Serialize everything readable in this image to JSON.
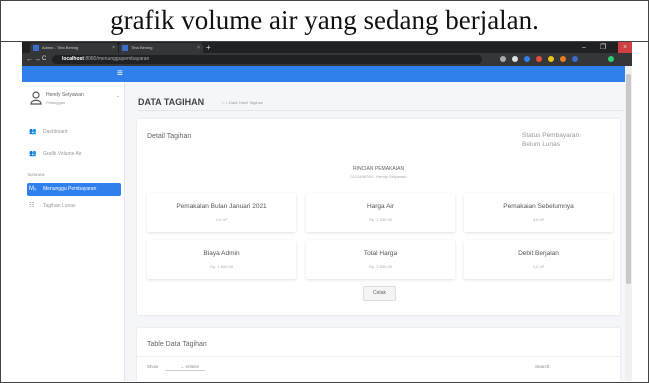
{
  "caption": "grafik volume air yang sedang berjalan.",
  "browser": {
    "tabs": [
      {
        "title": "Admin - Tirta Bening",
        "close": "×"
      },
      {
        "title": "Tirta Bening",
        "close": "×"
      }
    ],
    "new_tab": "+",
    "window_controls": {
      "minimize": "–",
      "maximize": "❐",
      "close": "×"
    },
    "nav": {
      "back": "←",
      "forward": "→",
      "reload": "C"
    },
    "url_host": "localhost",
    "url_path": ":8080/menunggupembayaran",
    "extension_colors": [
      "#aaaaaa",
      "#e0e0e0",
      "#2f80ed",
      "#e74c3c",
      "#f1c40f",
      "#e67e22",
      "#3b6cc9",
      "#2ecc71"
    ]
  },
  "topnav": {
    "menu_icon": "≡",
    "accent_color": "#2f80ed"
  },
  "sidebar": {
    "user_name": "Hendy Setyawan",
    "user_role": "Pelanggan",
    "user_caret": "⌄",
    "items": [
      {
        "icon": "👥",
        "label": "Dashboard"
      },
      {
        "icon": "👥",
        "label": "Grafik Volume Air"
      }
    ],
    "section_label": "TAGIHAN",
    "tagihan_items": [
      {
        "icon": "M₀",
        "label": "Menunggu Pembayaran",
        "active": true
      },
      {
        "icon": "☷",
        "label": "Tagihan Lunas",
        "active": false
      }
    ]
  },
  "main": {
    "page_title": "DATA TAGIHAN",
    "breadcrumb": "⌂  >  Data Tabel Tagihan",
    "detail_card": {
      "title": "Detail Tagihan",
      "status": "Status Pembayaran: Belum Lunas",
      "rincian_title": "RINCIAN PEMAKAIAN",
      "rincian_sub": "0123456789 - Hendy Setyawan",
      "boxes": [
        {
          "label": "Pemakalan Bulan Januari 2021",
          "value": "1,0 m³"
        },
        {
          "label": "Harga Air",
          "value": "Rp. 1.000,00"
        },
        {
          "label": "Pemakaian Sebelumnya",
          "value": "3,0 m³"
        },
        {
          "label": "Biaya Admin",
          "value": "Rp. 1.500,00"
        },
        {
          "label": "Total Harga",
          "value": "Rp. 2.500,00"
        },
        {
          "label": "Debit Berjalan",
          "value": "1,0 m³"
        }
      ],
      "print_button": "Cetak"
    },
    "table_card": {
      "title": "Table Data Tagihan",
      "show_label": "Show",
      "entries_label": "⌄ entries",
      "search_label": "Search:"
    }
  }
}
